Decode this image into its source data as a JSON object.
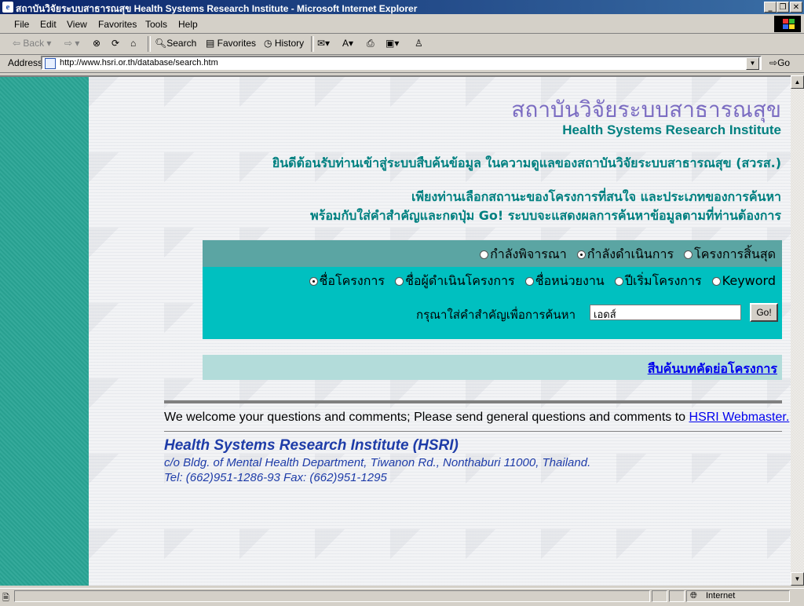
{
  "window": {
    "title": "สถาบันวิจัยระบบสาธารณสุข Health Systems Research Institute - Microsoft Internet Explorer"
  },
  "menu": [
    "File",
    "Edit",
    "View",
    "Favorites",
    "Tools",
    "Help"
  ],
  "toolbar": {
    "back": "Back",
    "search": "Search",
    "favorites": "Favorites",
    "history": "History"
  },
  "address": {
    "label": "Address",
    "url": "http://www.hsri.or.th/database/search.htm",
    "go": "Go"
  },
  "page": {
    "title_th": "สถาบันวิจัยระบบสาธารณสุข",
    "title_en": "Health Systems Research Institute",
    "welcome": "ยินดีต้อนรับท่านเข้าสู่ระบบสืบค้นข้อมูล ในความดูแลของสถาบันวิจัยระบบสาธารณสุข (สวรส.)",
    "instruction_1": "เพียงท่านเลือกสถานะของโครงการที่สนใจ และประเภทของการค้นหา",
    "instruction_2": "พร้อมกับใส่คำสำคัญและกดปุ่ม Go! ระบบจะแสดงผลการค้นหาข้อมูลตามที่ท่านต้องการ",
    "status_options": [
      {
        "label": "กำลังพิจารณา",
        "selected": false
      },
      {
        "label": "กำลังดำเนินการ",
        "selected": true
      },
      {
        "label": "โครงการสิ้นสุด",
        "selected": false
      }
    ],
    "search_type_options": [
      {
        "label": "ชื่อโครงการ",
        "selected": true
      },
      {
        "label": "ชื่อผู้ดำเนินโครงการ",
        "selected": false
      },
      {
        "label": "ชื่อหน่วยงาน",
        "selected": false
      },
      {
        "label": "ปีเริ่มโครงการ",
        "selected": false
      },
      {
        "label": "Keyword",
        "selected": false
      }
    ],
    "keyword_label": "กรุณาใส่คำสำคัญเพื่อการค้นหา",
    "keyword_value": "เอดส์",
    "go_button": "Go!",
    "abstract_link": "สืบค้นบทคัดย่อโครงการ",
    "comments_text": "We welcome your questions and comments; Please send general questions and comments to ",
    "webmaster_link": "HSRI Webmaster.",
    "org_name": "Health Systems Research Institute (HSRI)",
    "org_address": "c/o Bldg. of Mental Health Department, Tiwanon Rd., Nonthaburi 11000, Thailand.",
    "org_phone": "Tel: (662)951-1286-93 Fax: (662)951-1295"
  },
  "status": {
    "zone": "Internet"
  },
  "colors": {
    "accent_teal": "#008080",
    "form_top": "#5ba5a3",
    "form_main": "#00c0c0",
    "sidebar": "#2aa696",
    "title_th": "#7b6cc2",
    "org_blue": "#1e3ca8"
  }
}
